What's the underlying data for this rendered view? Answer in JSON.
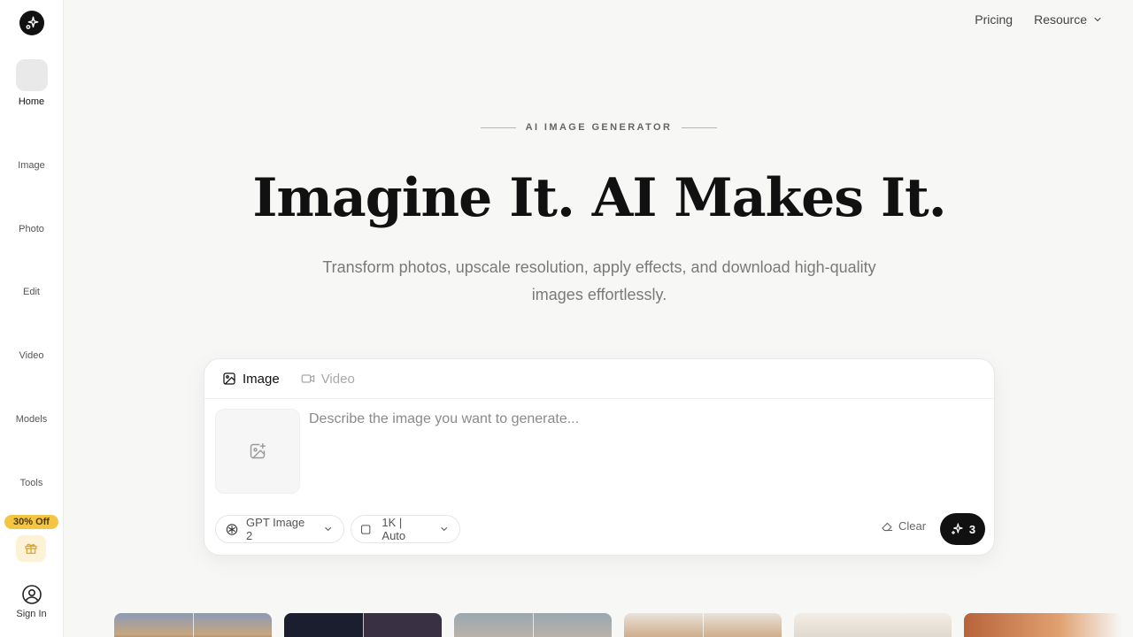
{
  "sidebar": {
    "items": [
      {
        "label": "Home",
        "icon": "home-icon",
        "active": true
      },
      {
        "label": "Image",
        "icon": "image-icon"
      },
      {
        "label": "Photo",
        "icon": "photo-icon"
      },
      {
        "label": "Edit",
        "icon": "edit-icon"
      },
      {
        "label": "Video",
        "icon": "video-icon"
      },
      {
        "label": "Models",
        "icon": "models-icon"
      },
      {
        "label": "Tools",
        "icon": "tools-icon"
      }
    ],
    "promo": "30% Off",
    "signin": "Sign In"
  },
  "topnav": {
    "pricing": "Pricing",
    "resource": "Resource"
  },
  "hero": {
    "eyebrow": "AI IMAGE GENERATOR",
    "title": "Imagine It. AI Makes It.",
    "subtitle": "Transform photos, upscale resolution, apply effects, and download high-quality images effortlessly."
  },
  "composer": {
    "tabs": [
      {
        "label": "Image",
        "active": true
      },
      {
        "label": "Video",
        "active": false
      }
    ],
    "prompt_placeholder": "Describe the image you want to generate...",
    "prompt_value": "",
    "model": "GPT Image 2",
    "resolution": "1K | Auto",
    "clear": "Clear",
    "credits": "3"
  },
  "colors": {
    "accent": "#111111",
    "promo": "#f5c542",
    "background": "#f7f7f6"
  }
}
